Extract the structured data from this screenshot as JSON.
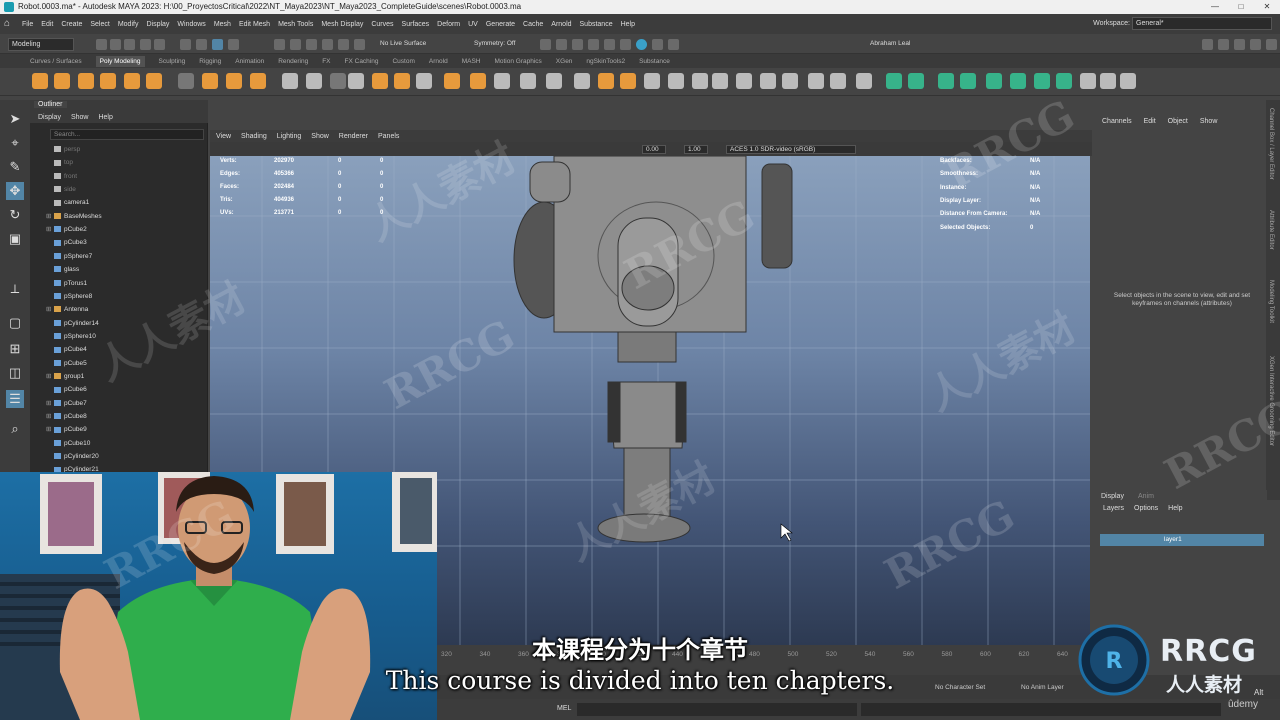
{
  "window": {
    "title": "Robot.0003.ma* - Autodesk MAYA 2023: H:\\00_ProyectosCritical\\2022\\NT_Maya2023\\NT_Maya2023_CompleteGuide\\scenes\\Robot.0003.ma",
    "controls": [
      "—",
      "□",
      "✕"
    ]
  },
  "menubar": {
    "items": [
      "File",
      "Edit",
      "Create",
      "Select",
      "Modify",
      "Display",
      "Windows",
      "Mesh",
      "Edit Mesh",
      "Mesh Tools",
      "Mesh Display",
      "Curves",
      "Surfaces",
      "Deform",
      "UV",
      "Generate",
      "Cache",
      "Arnold",
      "Substance",
      "Help"
    ],
    "workspace_label": "Workspace:",
    "workspace_value": "General*"
  },
  "statusline": {
    "mode": "Modeling",
    "live_surface": "No Live Surface",
    "symmetry": "Symmetry: Off",
    "user": "Abraham Leal"
  },
  "shelf": {
    "tabs": [
      "Curves / Surfaces",
      "Poly Modeling",
      "Sculpting",
      "Rigging",
      "Animation",
      "Rendering",
      "FX",
      "FX Caching",
      "Custom",
      "Arnold",
      "MASH",
      "Motion Graphics",
      "XGen",
      "ngSkinTools2",
      "Substance"
    ],
    "active_tab": "Poly Modeling"
  },
  "outliner": {
    "title": "Outliner",
    "menu": [
      "Display",
      "Show",
      "Help"
    ],
    "search_placeholder": "Search...",
    "items": [
      {
        "name": "persp",
        "dim": true,
        "expand": "",
        "icon": "camera-icon"
      },
      {
        "name": "top",
        "dim": true,
        "expand": "",
        "icon": "camera-icon"
      },
      {
        "name": "front",
        "dim": true,
        "expand": "",
        "icon": "camera-icon"
      },
      {
        "name": "side",
        "dim": true,
        "expand": "",
        "icon": "camera-icon"
      },
      {
        "name": "camera1",
        "dim": false,
        "expand": "",
        "icon": "camera-icon"
      },
      {
        "name": "BaseMeshes",
        "dim": false,
        "expand": "⊞",
        "icon": "group-icon"
      },
      {
        "name": "pCube2",
        "dim": false,
        "expand": "⊞",
        "icon": "mesh-icon"
      },
      {
        "name": "pCube3",
        "dim": false,
        "expand": "",
        "icon": "mesh-icon"
      },
      {
        "name": "pSphere7",
        "dim": false,
        "expand": "",
        "icon": "mesh-icon"
      },
      {
        "name": "glass",
        "dim": false,
        "expand": "",
        "icon": "mesh-icon"
      },
      {
        "name": "pTorus1",
        "dim": false,
        "expand": "",
        "icon": "mesh-icon"
      },
      {
        "name": "pSphere8",
        "dim": false,
        "expand": "",
        "icon": "mesh-icon"
      },
      {
        "name": "Antenna",
        "dim": false,
        "expand": "⊞",
        "icon": "group-icon"
      },
      {
        "name": "pCylinder14",
        "dim": false,
        "expand": "",
        "icon": "mesh-icon"
      },
      {
        "name": "pSphere10",
        "dim": false,
        "expand": "",
        "icon": "mesh-icon"
      },
      {
        "name": "pCube4",
        "dim": false,
        "expand": "",
        "icon": "mesh-icon"
      },
      {
        "name": "pCube5",
        "dim": false,
        "expand": "",
        "icon": "mesh-icon"
      },
      {
        "name": "group1",
        "dim": false,
        "expand": "⊞",
        "icon": "group-icon"
      },
      {
        "name": "pCube6",
        "dim": false,
        "expand": "",
        "icon": "mesh-icon"
      },
      {
        "name": "pCube7",
        "dim": false,
        "expand": "⊞",
        "icon": "mesh-icon"
      },
      {
        "name": "pCube8",
        "dim": false,
        "expand": "⊞",
        "icon": "mesh-icon"
      },
      {
        "name": "pCube9",
        "dim": false,
        "expand": "⊞",
        "icon": "mesh-icon"
      },
      {
        "name": "pCube10",
        "dim": false,
        "expand": "",
        "icon": "mesh-icon"
      },
      {
        "name": "pCylinder20",
        "dim": false,
        "expand": "",
        "icon": "mesh-icon"
      },
      {
        "name": "pCylinder21",
        "dim": false,
        "expand": "",
        "icon": "mesh-icon"
      }
    ]
  },
  "viewport": {
    "menu": [
      "View",
      "Shading",
      "Lighting",
      "Show",
      "Renderer",
      "Panels"
    ],
    "field_value_1": "0.00",
    "field_value_2": "1.00",
    "color_space": "ACES 1.0 SDR-video (sRGB)",
    "stats": [
      {
        "label": "Verts:",
        "value": "202970",
        "sel": "0",
        "comp": "0"
      },
      {
        "label": "Edges:",
        "value": "405366",
        "sel": "0",
        "comp": "0"
      },
      {
        "label": "Faces:",
        "value": "202484",
        "sel": "0",
        "comp": "0"
      },
      {
        "label": "Tris:",
        "value": "404936",
        "sel": "0",
        "comp": "0"
      },
      {
        "label": "UVs:",
        "value": "213771",
        "sel": "0",
        "comp": "0"
      }
    ],
    "hud_right": [
      {
        "label": "Backfaces:",
        "value": "N/A"
      },
      {
        "label": "Smoothness:",
        "value": "N/A"
      },
      {
        "label": "Instance:",
        "value": "N/A"
      },
      {
        "label": "Display Layer:",
        "value": "N/A"
      },
      {
        "label": "Distance From Camera:",
        "value": "N/A"
      },
      {
        "label": "Selected Objects:",
        "value": "0"
      }
    ]
  },
  "channelbox": {
    "menu": [
      "Channels",
      "Edit",
      "Object",
      "Show"
    ],
    "hint": "Select objects in the scene to view, edit and set keyframes on channels (attributes)",
    "side_tabs": [
      "Channel Box / Layer Editor",
      "Attribute Editor",
      "Modeling Toolkit",
      "XGen Interactive Grooming Editor"
    ]
  },
  "layer_editor": {
    "tabs": [
      "Display",
      "Anim"
    ],
    "menu": [
      "Layers",
      "Options",
      "Help"
    ],
    "layer_name": "layer1"
  },
  "timeline": {
    "ticks": [
      "320",
      "340",
      "360",
      "380",
      "400",
      "420",
      "440",
      "460",
      "480",
      "500",
      "520",
      "540",
      "560",
      "580",
      "600",
      "620",
      "640"
    ],
    "character_set": "No Character Set",
    "anim_layer": "No Anim Layer",
    "command_label": "MEL"
  },
  "subtitles": {
    "cn": "本课程分为十个章节",
    "en": "This course is divided into ten chapters."
  },
  "branding": {
    "logo_text": "RRCG",
    "logo_sub": "人人素材",
    "watermark": "RRCG",
    "watermark_cn": "人人素材",
    "platform": "ûdemy",
    "alt_badge": "Alt"
  },
  "colors": {
    "selection_blue": "#5285a6",
    "shelf_orange": "#e79a3c",
    "shelf_green": "#37b38a",
    "viewport_top": "#8aa0bc",
    "viewport_bottom": "#2d3a52",
    "shirt_green": "#2fae4c"
  }
}
